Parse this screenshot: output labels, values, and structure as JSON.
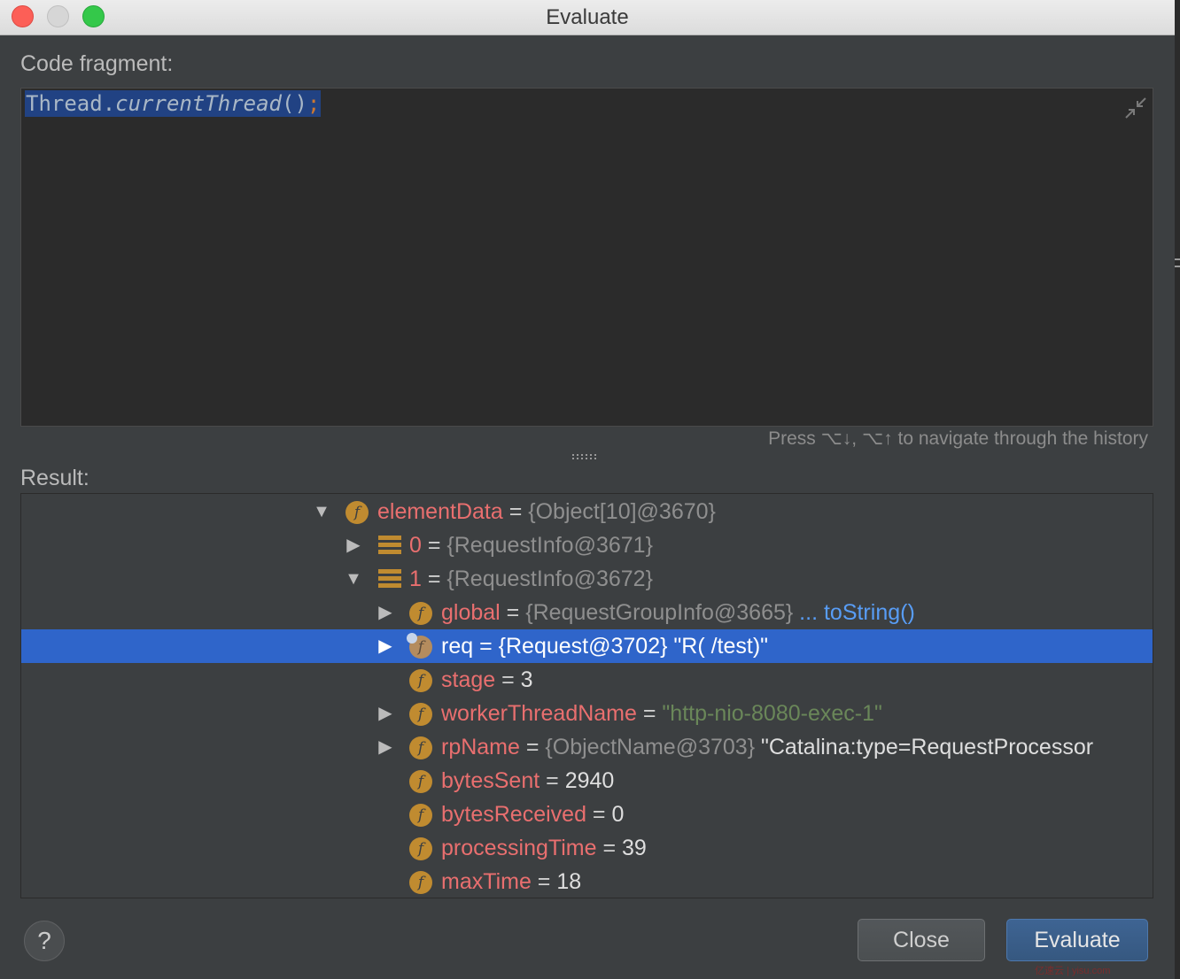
{
  "window": {
    "title": "Evaluate"
  },
  "code_fragment": {
    "label": "Code fragment:",
    "code_class": "Thread",
    "code_dot": ".",
    "code_method": "currentThread",
    "code_parens": "()",
    "code_semicolon": ";"
  },
  "history_hint": "Press ⌥↓, ⌥↑ to navigate through the history",
  "result": {
    "label": "Result:",
    "rows": [
      {
        "name": "elementData",
        "eq": " = ",
        "value": "{Object[10]@3670}"
      },
      {
        "name": "0",
        "eq": " = ",
        "value": "{RequestInfo@3671}"
      },
      {
        "name": "1",
        "eq": " = ",
        "value": "{RequestInfo@3672}"
      },
      {
        "name": "global",
        "eq": " = ",
        "value": "{RequestGroupInfo@3665}",
        "link": " ... toString()"
      },
      {
        "name": "req",
        "eq": " = ",
        "value": "{Request@3702} \"R( /test)\""
      },
      {
        "name": "stage",
        "eq": " = ",
        "value": "3"
      },
      {
        "name": "workerThreadName",
        "eq": " = ",
        "value": "\"http-nio-8080-exec-1\""
      },
      {
        "name": "rpName",
        "eq": " = ",
        "value": "{ObjectName@3703}",
        "extra": " \"Catalina:type=RequestProcessor"
      },
      {
        "name": "bytesSent",
        "eq": " = ",
        "value": "2940"
      },
      {
        "name": "bytesReceived",
        "eq": " = ",
        "value": "0"
      },
      {
        "name": "processingTime",
        "eq": " = ",
        "value": "39"
      },
      {
        "name": "maxTime",
        "eq": " = ",
        "value": "18"
      }
    ]
  },
  "buttons": {
    "help": "?",
    "close": "Close",
    "evaluate": "Evaluate"
  },
  "watermark": "亿速云 | yisu.com",
  "icons": {
    "field": "field-f-icon",
    "array_element": "array-element-icon",
    "expand": "tree-expand-arrow-icon",
    "collapse": "tree-collapse-arrow-icon",
    "shrink_editor": "collapse-editor-icon"
  },
  "colors": {
    "background": "#3c3f41",
    "editor_bg": "#2b2b2b",
    "selection": "#2f65ca",
    "field_name": "#e96f6f",
    "string_value": "#6a8759",
    "link": "#589df6",
    "field_icon": "#c08b30"
  }
}
